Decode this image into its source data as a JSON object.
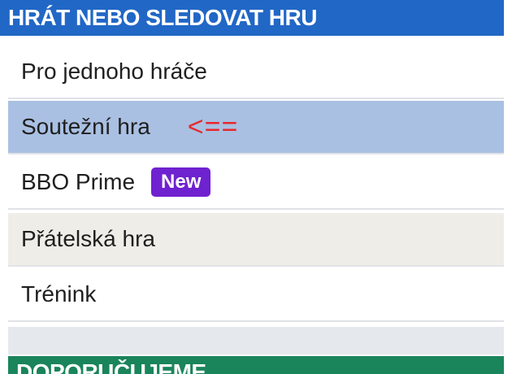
{
  "header": {
    "title": "HRÁT NEBO SLEDOVAT HRU"
  },
  "menu": {
    "items": [
      {
        "label": "Pro jednoho hráče"
      },
      {
        "label": "Soutežní hra",
        "annotation": "<=="
      },
      {
        "label": "BBO Prime",
        "badge": "New"
      },
      {
        "label": "Přátelská hra"
      },
      {
        "label": "Trénink"
      }
    ]
  },
  "footer": {
    "title": "DOPORUČUJEME"
  },
  "colors": {
    "header_bg": "#2167c6",
    "selected_bg": "#a9c0e2",
    "alt_bg": "#eeede7",
    "badge_bg": "#6f22cf",
    "annotation": "#e8292b",
    "footer_bg": "#1a845b"
  }
}
